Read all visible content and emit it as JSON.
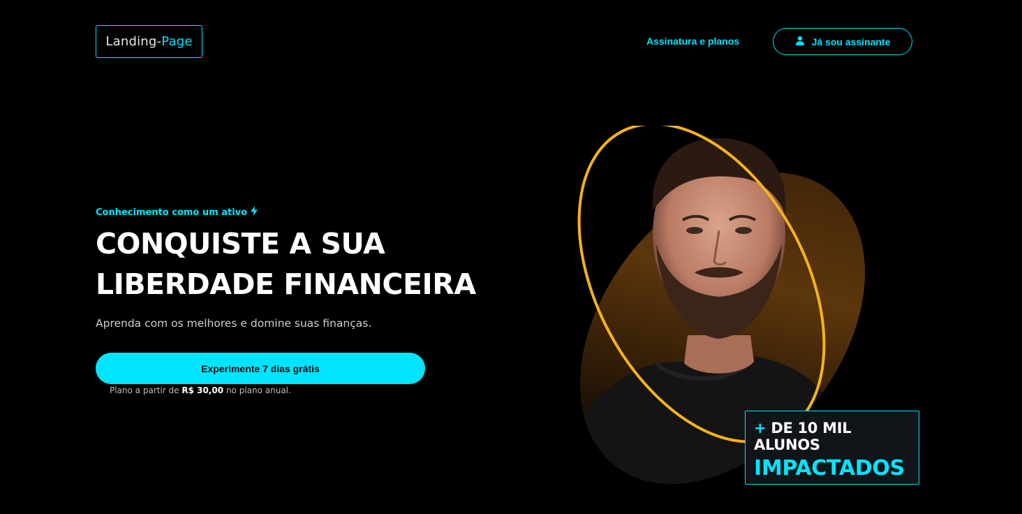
{
  "header": {
    "logo_text": "Landing-",
    "logo_accent": "Page",
    "nav_link": "Assinatura e planos",
    "login_button": "Já sou assinante",
    "login_icon": "user-icon"
  },
  "hero": {
    "eyebrow": "Conhecimento como um ativo",
    "eyebrow_icon": "lightning-icon",
    "headline_line1": "CONQUISTE A SUA",
    "headline_line2": "LIBERDADE FINANCEIRA",
    "subtitle": "Aprenda com os melhores e domine suas finanças.",
    "cta_label": "Experimente 7 dias grátis",
    "price_prefix": "Plano a partir de",
    "price_value": "R$ 30,00",
    "price_suffix": "no plano anual."
  },
  "badge": {
    "plus": "+",
    "line1": "DE 10 MIL ALUNOS",
    "line2": "IMPACTADOS"
  },
  "colors": {
    "accent": "#00e5ff",
    "ring": "#f5b31a",
    "background": "#000000"
  }
}
